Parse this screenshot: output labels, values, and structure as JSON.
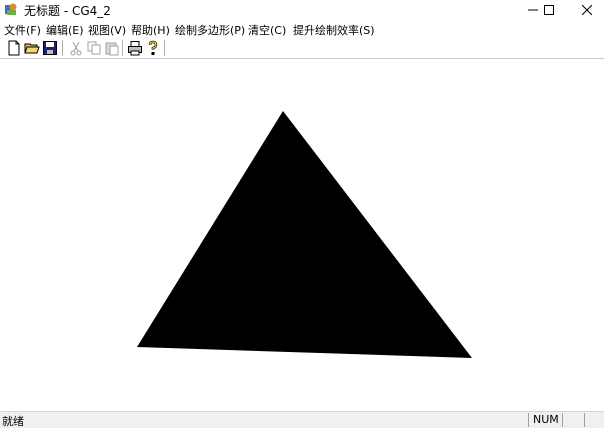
{
  "window": {
    "title": "无标题 - CG4_2"
  },
  "menu": {
    "items": [
      {
        "label": "文件(F)"
      },
      {
        "label": "编辑(E)"
      },
      {
        "label": "视图(V)"
      },
      {
        "label": "帮助(H)"
      },
      {
        "label": "绘制多边形(P)"
      },
      {
        "label": "清空(C)"
      },
      {
        "label": "提升绘制效率(S)"
      }
    ]
  },
  "toolbar": {
    "buttons": [
      {
        "icon": "new-file-icon",
        "enabled": true
      },
      {
        "icon": "open-folder-icon",
        "enabled": true
      },
      {
        "icon": "save-icon",
        "enabled": true
      },
      {
        "icon": "cut-icon",
        "enabled": false
      },
      {
        "icon": "copy-icon",
        "enabled": false
      },
      {
        "icon": "paste-icon",
        "enabled": false
      },
      {
        "icon": "print-icon",
        "enabled": true
      },
      {
        "icon": "help-icon",
        "enabled": true
      }
    ]
  },
  "canvas": {
    "shape": "filled triangle",
    "fill_color": "#000000"
  },
  "statusbar": {
    "text": "就绪",
    "num_indicator": "NUM"
  }
}
